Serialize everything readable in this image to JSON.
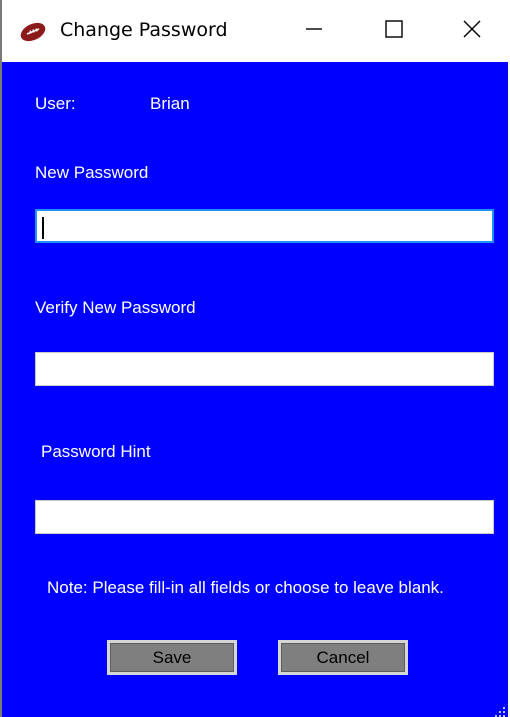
{
  "window": {
    "title": "Change Password",
    "icon": "football-icon",
    "controls": [
      "minimize-icon",
      "maximize-icon",
      "close-icon"
    ]
  },
  "form": {
    "user_label": "User:",
    "user_value": "Brian",
    "new_password_label": "New Password",
    "new_password_value": "",
    "verify_password_label": "Verify New Password",
    "verify_password_value": "",
    "hint_label": "Password Hint",
    "hint_value": "",
    "note": "Note: Please fill-in all fields or choose to leave blank.",
    "save_label": "Save",
    "cancel_label": "Cancel"
  },
  "colors": {
    "background": "#0000ff",
    "text": "#ffffff",
    "button": "#7f7f7f",
    "focus_border": "#1e90ff"
  }
}
